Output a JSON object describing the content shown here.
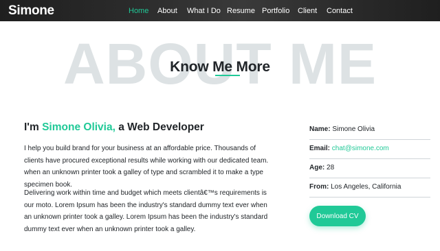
{
  "navbar": {
    "brand": "Simone",
    "links": [
      {
        "label": "Home",
        "active": true
      },
      {
        "label": "About",
        "active": false
      },
      {
        "label": "What I Do",
        "active": false
      },
      {
        "label": "Resume",
        "active": false
      },
      {
        "label": "Portfolio",
        "active": false
      },
      {
        "label": "Client",
        "active": false
      },
      {
        "label": "Contact",
        "active": false
      }
    ]
  },
  "section": {
    "background_title": "ABOUT ME",
    "title": "Know Me More"
  },
  "intro": {
    "prefix": "I'm ",
    "name": "Simone Olivia,",
    "suffix": " a Web Developer",
    "paragraphs": [
      "I help you build brand for your business at an affordable price. Thousands of clients have procured exceptional results while working with our dedicated team. when an unknown printer took a galley of type and scrambled it to make a type specimen book.",
      "Delivering work within time and budget which meets clientâ€™s requirements is our moto. Lorem Ipsum has been the industry's standard dummy text ever when an unknown printer took a galley. Lorem Ipsum has been the industry's standard dummy text ever when an unknown printer took a galley."
    ]
  },
  "info": {
    "name_label": "Name:",
    "name_value": "Simone Olivia",
    "email_label": "Email:",
    "email_value": "chat@simone.com",
    "age_label": "Age:",
    "age_value": "28",
    "from_label": "From:",
    "from_value": "Los Angeles, California"
  },
  "download_button": "Download CV",
  "colors": {
    "accent": "#20c997",
    "navbar_bg": "#2b2b2b",
    "background_title": "#dde2e4"
  }
}
